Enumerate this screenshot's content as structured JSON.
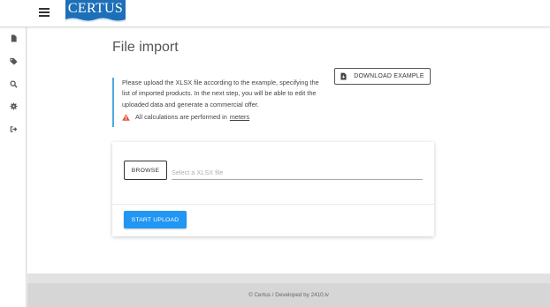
{
  "header": {
    "menu_icon": "hamburger-icon",
    "logo_text": "CERTUS",
    "brand_color": "#1d6fb8"
  },
  "sidebar": {
    "items": [
      {
        "icon": "file-icon"
      },
      {
        "icon": "tags-icon"
      },
      {
        "icon": "search-icon"
      },
      {
        "icon": "gear-icon"
      },
      {
        "icon": "sign-out-icon"
      }
    ]
  },
  "main": {
    "title": "File import",
    "info": {
      "text": "Please upload the XLSX file according to the example, specifying the list of imported products. In the next step, you will be able to edit the uploaded data and generate a commercial offer.",
      "warning_text": "All calculations are performed in",
      "warning_link": "meters",
      "warning_icon": "warning-icon",
      "accent_color": "#4ea8e0"
    },
    "download_button": {
      "label": "DOWNLOAD EXAMPLE",
      "icon": "file-download-icon"
    },
    "upload_card": {
      "browse_label": "BROWSE",
      "file_placeholder": "Select a XLSX file",
      "file_value": "",
      "upload_label": "START UPLOAD",
      "upload_color": "#2196f3"
    }
  },
  "footer": {
    "text": "© Certus / Developed by 2410.lv"
  }
}
